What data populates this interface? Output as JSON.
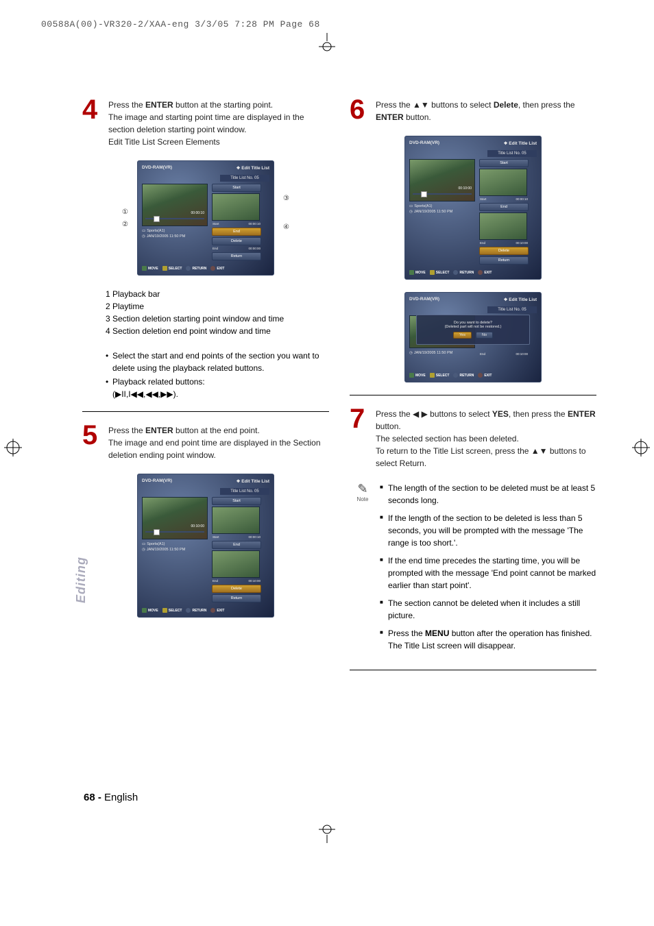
{
  "header_line": "00588A(00)-VR320-2/XAA-eng  3/3/05  7:28 PM  Page 68",
  "side_tab": "Editing",
  "footer": {
    "page": "68 -",
    "lang": "English"
  },
  "left": {
    "step4": {
      "num": "4",
      "l1a": "Press the ",
      "l1b": "ENTER",
      "l1c": " button at the starting point.",
      "l2": "The image and starting point time are displayed in the section deletion starting point window.",
      "l3": "Edit Title List Screen Elements"
    },
    "osd4": {
      "media": "DVD-RAM(VR)",
      "menu": "Edit Title List",
      "title_no": "Title List No. 05",
      "progress_time": "00:00:10",
      "info_title": "Sports(A1)",
      "info_date": "JAN/19/2005 11:50 PM",
      "start_lbl": "Start",
      "start_val": "00:00:10",
      "end_lbl": "End",
      "end_val": "00:00:00",
      "btn_start": "Start",
      "btn_end": "End",
      "btn_delete": "Delete",
      "btn_return": "Return",
      "move": "MOVE",
      "select": "SELECT",
      "return": "RETURN",
      "exit": "EXIT"
    },
    "callouts": {
      "c1": "①",
      "c2": "②",
      "c3": "③",
      "c4": "④"
    },
    "numlist": {
      "i1": "1 Playback bar",
      "i2": "2 Playtime",
      "i3": "3 Section deletion starting point window and time",
      "i4": "4 Section deletion end point window and time"
    },
    "bullets": {
      "b1": "Select the start and end points of the section you want to delete using the playback related buttons.",
      "b2": "Playback related buttons:"
    },
    "pb_symbols": "(▶II,I◀◀,◀◀,▶▶).",
    "step5": {
      "num": "5",
      "l1a": "Press the ",
      "l1b": "ENTER",
      "l1c": " button at the end point.",
      "l2": "The image and end point time are displayed in the Section deletion ending point window."
    },
    "osd5": {
      "media": "DVD-RAM(VR)",
      "menu": "Edit Title List",
      "title_no": "Title List No. 05",
      "progress_time": "00:10:00",
      "info_title": "Sports(A1)",
      "info_date": "JAN/19/2005 11:50 PM",
      "start_lbl": "Start",
      "start_val": "00:00:10",
      "end_lbl": "End",
      "end_val": "00:10:00",
      "btn_start": "Start",
      "btn_end": "End",
      "btn_delete": "Delete",
      "btn_return": "Return",
      "move": "MOVE",
      "select": "SELECT",
      "return": "RETURN",
      "exit": "EXIT"
    }
  },
  "right": {
    "step6": {
      "num": "6",
      "l1a": "Press the ▲▼ buttons to select ",
      "l1b": "Delete",
      "l1c": ", then press the ",
      "l1d": "ENTER",
      "l1e": " button."
    },
    "osd6a": {
      "media": "DVD-RAM(VR)",
      "menu": "Edit Title List",
      "title_no": "Title List No. 05",
      "progress_time": "00:10:00",
      "info_title": "Sports(A1)",
      "info_date": "JAN/19/2005 11:50 PM",
      "start_lbl": "Start",
      "start_val": "00:00:10",
      "end_lbl": "End",
      "end_val": "00:10:00",
      "btn_start": "Start",
      "btn_end": "End",
      "btn_delete": "Delete",
      "btn_return": "Return",
      "move": "MOVE",
      "select": "SELECT",
      "return": "RETURN",
      "exit": "EXIT"
    },
    "osd6b": {
      "media": "DVD-RAM(VR)",
      "menu": "Edit Title List",
      "title_no": "Title List No. 05",
      "dialog_l1": "Do you want to delete?",
      "dialog_l2": "(Deleted part will not be restored.)",
      "yes": "Yes",
      "no": "No",
      "info_date": "JAN/19/2005 11:50 PM",
      "end_lbl": "End",
      "end_val": "00:10:00",
      "move": "MOVE",
      "select": "SELECT",
      "return": "RETURN",
      "exit": "EXIT"
    },
    "step7": {
      "num": "7",
      "l1a": "Press the ◀ ▶ buttons to select ",
      "l1b": "YES",
      "l1c": ", then press the ",
      "l1d": "ENTER",
      "l1e": " button.",
      "l2": "The selected section has been deleted.",
      "l3": "To return to the Title List screen, press the ▲▼ buttons to select Return."
    },
    "note_label": "Note",
    "notes": {
      "n1": "The length of the section to be deleted must be at least 5 seconds long.",
      "n2": "If the length of the section to be deleted is less than 5 seconds, you will be prompted with the message 'The range is too short.'.",
      "n3": "If the end time precedes the starting time, you will be prompted with the message 'End point cannot be marked earlier than start point'.",
      "n4": "The section cannot be deleted when it includes a still picture.",
      "n5a": "Press the ",
      "n5b": "MENU",
      "n5c": " button after the operation has finished.",
      "n5d": "The Title List screen will disappear."
    }
  }
}
